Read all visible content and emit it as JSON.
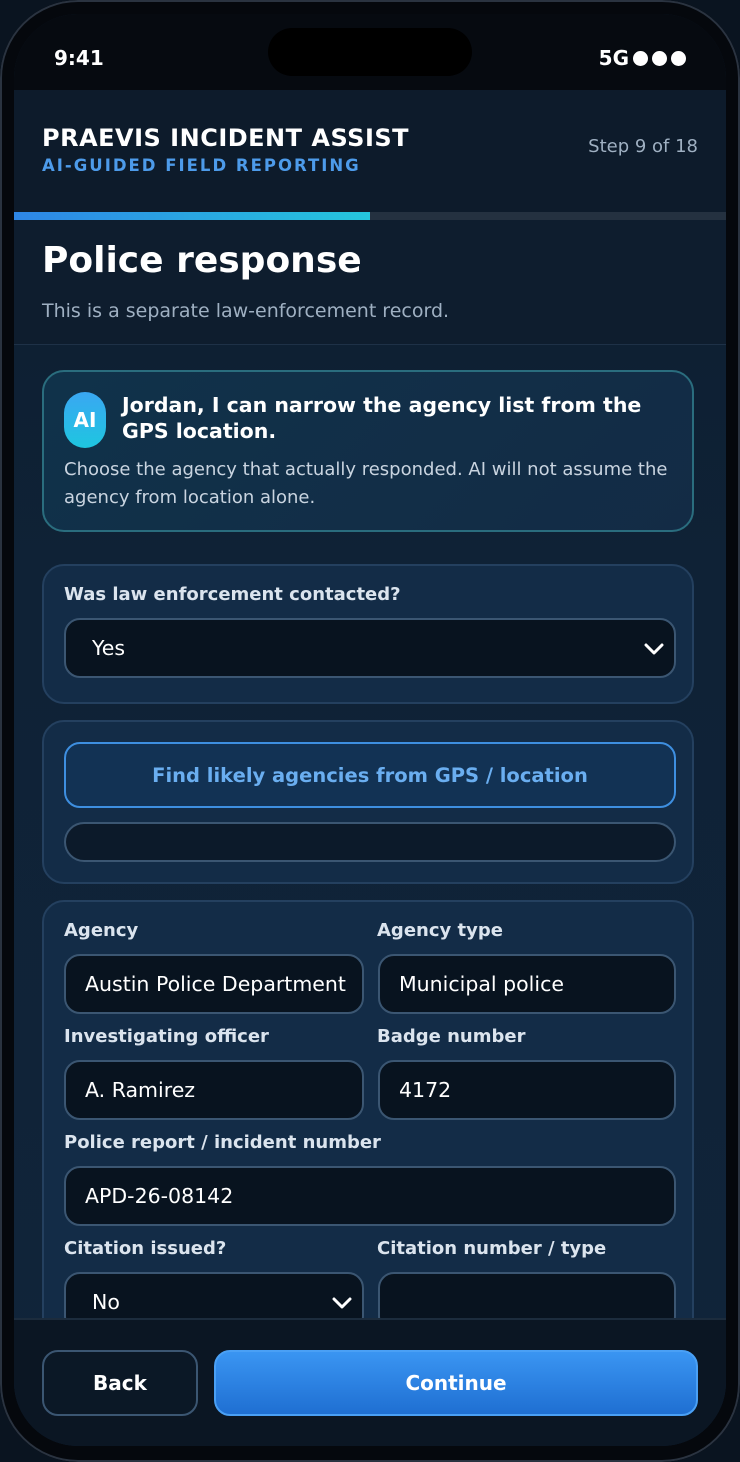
{
  "status": {
    "time": "9:41",
    "network": "5G"
  },
  "header": {
    "title": "PRAEVIS INCIDENT ASSIST",
    "subtitle": "AI-GUIDED FIELD REPORTING",
    "step": "Step 9 of 18",
    "progress": 0.5
  },
  "page": {
    "title": "Police response",
    "subtitle": "This is a separate law-enforcement record."
  },
  "ai_card": {
    "badge": "AI",
    "headline": "Jordan, I can narrow the agency list from the GPS location.",
    "body": "Choose the agency that actually responded. AI will not assume the agency from location alone."
  },
  "contact": {
    "label": "Was law enforcement contacted?",
    "value": "Yes"
  },
  "lookup": {
    "button": "Find likely agencies from GPS / location"
  },
  "form": {
    "agency_label": "Agency",
    "agency_value": "Austin Police Department",
    "agency_type_label": "Agency type",
    "agency_type_value": "Municipal police",
    "officer_label": "Investigating officer",
    "officer_value": "A. Ramirez",
    "badge_label": "Badge number",
    "badge_value": "4172",
    "report_label": "Police report / incident number",
    "report_value": "APD-26-08142",
    "citation_label": "Citation issued?",
    "citation_value": "No",
    "citation_number_label": "Citation number / type",
    "citation_number_value": ""
  },
  "footer": {
    "back": "Back",
    "continue": "Continue"
  },
  "colors": {
    "accent": "#2e86e6",
    "accent_teal": "#25c6dc",
    "link_blue": "#4d9bea"
  }
}
